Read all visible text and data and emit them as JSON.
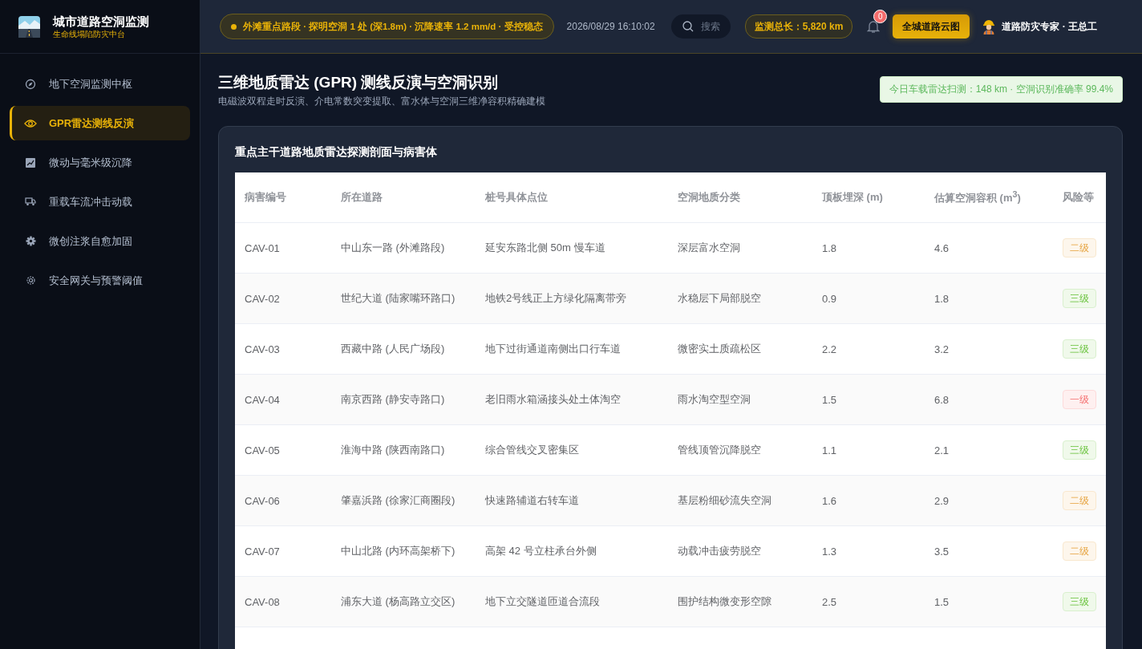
{
  "brand": {
    "title": "城市道路空洞监测",
    "subtitle": "生命线塌陷防灾中台"
  },
  "nav": [
    {
      "label": "地下空洞监测中枢",
      "kind": "compass",
      "selected": false
    },
    {
      "label": "GPR雷达测线反演",
      "kind": "eye",
      "selected": true
    },
    {
      "label": "微动与毫米级沉降",
      "kind": "chart",
      "selected": false
    },
    {
      "label": "重载车流冲击动载",
      "kind": "truck",
      "selected": false
    },
    {
      "label": "微创注浆自愈加固",
      "kind": "cog",
      "selected": false
    },
    {
      "label": "安全网关与预警阈值",
      "kind": "gear",
      "selected": false
    }
  ],
  "topbar": {
    "ticker": "外滩重点路段 · 探明空洞 1 处 (深1.8m) · 沉降速率 1.2 mm/d · 受控稳态",
    "datetime": "2026/08/29 16:10:02",
    "search": {
      "placeholder": "搜索"
    },
    "total": "监测总长：5,820 km",
    "notifications": "0",
    "cta": "全城道路云图",
    "user": "道路防灾专家 · 王总工"
  },
  "page": {
    "title": "三维地质雷达 (GPR) 测线反演与空洞识别",
    "subtitle": "电磁波双程走时反演、介电常数突变提取、富水体与空洞三维净容积精确建模",
    "stat": "今日车载雷达扫测：148 km · 空洞识别准确率 99.4%"
  },
  "table": {
    "title": "重点主干道路地质雷达探测剖面与病害体",
    "columns": [
      "病害编号",
      "所在道路",
      "桩号具体点位",
      "空洞地质分类",
      "顶板埋深 (m)",
      "估算空洞容积 (m$^{3}$)",
      "风险等"
    ],
    "rows": [
      {
        "cells": [
          "CAV-01",
          "中山东一路 (外滩路段)",
          "延安东路北侧 50m 慢车道",
          "深层富水空洞",
          "1.8",
          "4.6"
        ],
        "risk": {
          "label": "二级",
          "color": "#e6a23c"
        }
      },
      {
        "cells": [
          "CAV-02",
          "世纪大道 (陆家嘴环路口)",
          "地铁2号线正上方绿化隔离带旁",
          "水稳层下局部脱空",
          "0.9",
          "1.8"
        ],
        "risk": {
          "label": "三级",
          "color": "#67c23a"
        }
      },
      {
        "cells": [
          "CAV-03",
          "西藏中路 (人民广场段)",
          "地下过街通道南侧出口行车道",
          "微密实土质疏松区",
          "2.2",
          "3.2"
        ],
        "risk": {
          "label": "三级",
          "color": "#67c23a"
        }
      },
      {
        "cells": [
          "CAV-04",
          "南京西路 (静安寺路口)",
          "老旧雨水箱涵接头处土体淘空",
          "雨水淘空型空洞",
          "1.5",
          "6.8"
        ],
        "risk": {
          "label": "一级",
          "color": "#f56c6c"
        }
      },
      {
        "cells": [
          "CAV-05",
          "淮海中路 (陕西南路口)",
          "综合管线交叉密集区",
          "管线顶管沉降脱空",
          "1.1",
          "2.1"
        ],
        "risk": {
          "label": "三级",
          "color": "#67c23a"
        }
      },
      {
        "cells": [
          "CAV-06",
          "肇嘉浜路 (徐家汇商圈段)",
          "快速路辅道右转车道",
          "基层粉细砂流失空洞",
          "1.6",
          "2.9"
        ],
        "risk": {
          "label": "二级",
          "color": "#e6a23c"
        }
      },
      {
        "cells": [
          "CAV-07",
          "中山北路 (内环高架桥下)",
          "高架 42 号立柱承台外侧",
          "动载冲击疲劳脱空",
          "1.3",
          "3.5"
        ],
        "risk": {
          "label": "二级",
          "color": "#e6a23c"
        }
      },
      {
        "cells": [
          "CAV-08",
          "浦东大道 (杨高路立交区)",
          "地下立交隧道匝道合流段",
          "围护结构微变形空隙",
          "2.5",
          "1.5"
        ],
        "risk": {
          "label": "三级",
          "color": "#67c23a"
        }
      }
    ]
  }
}
